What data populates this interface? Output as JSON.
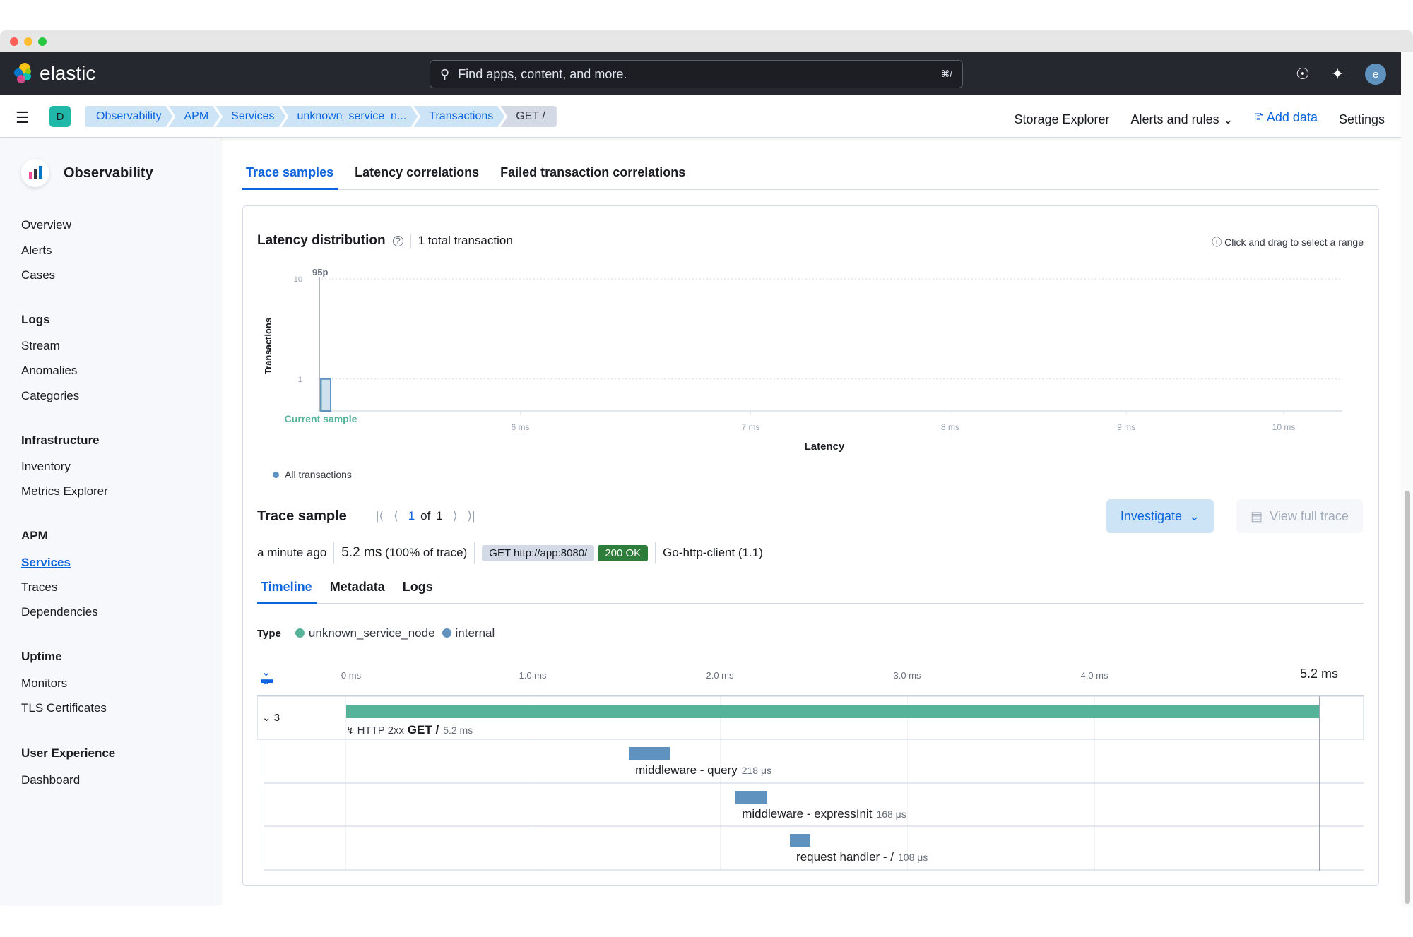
{
  "header": {
    "brand": "elastic",
    "search_placeholder": "Find apps, content, and more.",
    "search_shortcut": "⌘/",
    "avatar_initial": "e"
  },
  "breadcrumbs": {
    "space": "D",
    "items": [
      "Observability",
      "APM",
      "Services",
      "unknown_service_n...",
      "Transactions",
      "GET /"
    ]
  },
  "top_nav": {
    "storage_explorer": "Storage Explorer",
    "alerts_rules": "Alerts and rules",
    "add_data": "Add data",
    "settings": "Settings"
  },
  "sidebar": {
    "title": "Observability",
    "top_items": [
      "Overview",
      "Alerts",
      "Cases"
    ],
    "sections": [
      {
        "heading": "Logs",
        "items": [
          "Stream",
          "Anomalies",
          "Categories"
        ]
      },
      {
        "heading": "Infrastructure",
        "items": [
          "Inventory",
          "Metrics Explorer"
        ]
      },
      {
        "heading": "APM",
        "items": [
          "Services",
          "Traces",
          "Dependencies"
        ],
        "active": "Services"
      },
      {
        "heading": "Uptime",
        "items": [
          "Monitors",
          "TLS Certificates"
        ]
      },
      {
        "heading": "User Experience",
        "items": [
          "Dashboard"
        ]
      }
    ]
  },
  "main_tabs": [
    {
      "label": "Trace samples",
      "active": true
    },
    {
      "label": "Latency correlations"
    },
    {
      "label": "Failed transaction correlations"
    }
  ],
  "latency": {
    "title": "Latency distribution",
    "count": "1 total transaction",
    "hint": "Click and drag to select a range",
    "legend": "All transactions",
    "current_sample": "Current sample",
    "percentile_label": "95p"
  },
  "chart_data": {
    "type": "bar",
    "xlabel": "Latency",
    "ylabel": "Transactions",
    "x_scale": "log",
    "y_scale": "log",
    "xlim": [
      5.24,
      10.4
    ],
    "ylim": [
      0.48,
      10.5
    ],
    "x_ticks": [
      {
        "value": 6,
        "label": "6 ms"
      },
      {
        "value": 7,
        "label": "7 ms"
      },
      {
        "value": 8,
        "label": "8 ms"
      },
      {
        "value": 9,
        "label": "9 ms"
      },
      {
        "value": 10,
        "label": "10 ms"
      }
    ],
    "y_ticks": [
      {
        "value": 10,
        "label": "10"
      },
      {
        "value": 1,
        "label": "1"
      }
    ],
    "bars": [
      {
        "x0": 5.25,
        "x1": 5.28,
        "value": 1
      }
    ],
    "markers": [
      {
        "label": "95p",
        "x": 5.245
      },
      {
        "label": "Current sample",
        "x": 5.25
      }
    ],
    "grid": "horizontal dotted",
    "legend": "bottom-left",
    "colors": {
      "bar": "#6092c0",
      "current": "#54b399"
    }
  },
  "trace_sample": {
    "title": "Trace sample",
    "page": "1",
    "of": "of",
    "total": "1",
    "investigate": "Investigate",
    "view_full_trace": "View full trace",
    "time_ago": "a minute ago",
    "duration": "5.2 ms",
    "duration_pct": "(100% of trace)",
    "url_badge": "GET http://app:8080/",
    "status_badge": "200 OK",
    "user_agent": "Go-http-client (1.1)",
    "tabs": [
      {
        "label": "Timeline",
        "active": true
      },
      {
        "label": "Metadata"
      },
      {
        "label": "Logs"
      }
    ],
    "type_label": "Type",
    "types": [
      {
        "name": "unknown_service_node",
        "color": "#54b399"
      },
      {
        "name": "internal",
        "color": "#6092c0"
      }
    ]
  },
  "waterfall": {
    "total_ms": 5.2,
    "total_label": "5.2 ms",
    "ticks": [
      {
        "ms": 0,
        "label": "0 ms"
      },
      {
        "ms": 1,
        "label": "1.0 ms"
      },
      {
        "ms": 2,
        "label": "2.0 ms"
      },
      {
        "ms": 3,
        "label": "3.0 ms"
      },
      {
        "ms": 4,
        "label": "4.0 ms"
      }
    ],
    "child_count": "3",
    "root": {
      "status": "HTTP 2xx",
      "name": "GET /",
      "duration": "5.2 ms",
      "start_ms": 0,
      "duration_ms": 5.2,
      "color": "#54b399"
    },
    "spans": [
      {
        "name": "middleware - query",
        "duration": "218 μs",
        "start_ms": 1.51,
        "duration_ms": 0.218,
        "color": "#6092c0"
      },
      {
        "name": "middleware - expressInit",
        "duration": "168 μs",
        "start_ms": 2.08,
        "duration_ms": 0.168,
        "color": "#6092c0"
      },
      {
        "name": "request handler - /",
        "duration": "108 μs",
        "start_ms": 2.37,
        "duration_ms": 0.108,
        "color": "#6092c0"
      }
    ]
  }
}
